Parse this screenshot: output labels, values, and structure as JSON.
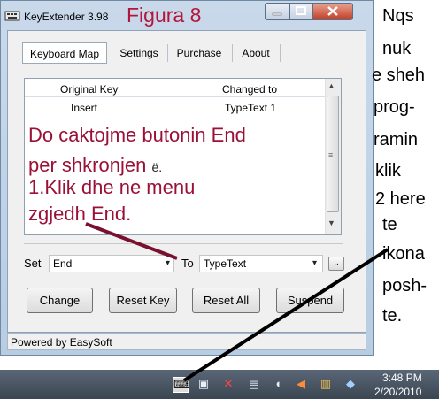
{
  "window": {
    "title": "KeyExtender 3.98",
    "annotation_title": "Figura 8",
    "status": "Powered by EasySoft"
  },
  "tabs": [
    "Keyboard Map",
    "Settings",
    "Purchase",
    "About"
  ],
  "table": {
    "columns": [
      "Original Key",
      "Changed to"
    ],
    "rows": [
      [
        "Insert",
        "TypeText 1"
      ]
    ]
  },
  "annotations": {
    "line1": "Do caktojme butonin End",
    "line2": "per shkronjen",
    "line2_small": "ë.",
    "line3": "1.Klik dhe ne menu",
    "line4": "zgjedh End."
  },
  "mapping": {
    "set_label": "Set",
    "set_value": "End",
    "to_label": "To",
    "to_value": "TypeText",
    "dots_label": ".."
  },
  "buttons": {
    "change": "Change",
    "reset_key": "Reset Key",
    "reset_all": "Reset All",
    "suspend": "Suspend"
  },
  "side_text": [
    "Nqs",
    "nuk",
    "e sheh",
    "prog-",
    "ramin",
    "klik",
    "2 here",
    "te",
    "ikona",
    "posh-",
    "te."
  ],
  "taskbar": {
    "time": "3:48 PM",
    "date": "2/20/2010",
    "tray_icons": [
      "keyextender-tray-icon",
      "printer-icon",
      "no-connection-icon",
      "network-icon",
      "speaker-muted-icon",
      "volume-icon",
      "notepad-icon",
      "balloon-icon"
    ]
  },
  "colors": {
    "annotation": "#9b1037",
    "arrow": "#7a1030"
  }
}
